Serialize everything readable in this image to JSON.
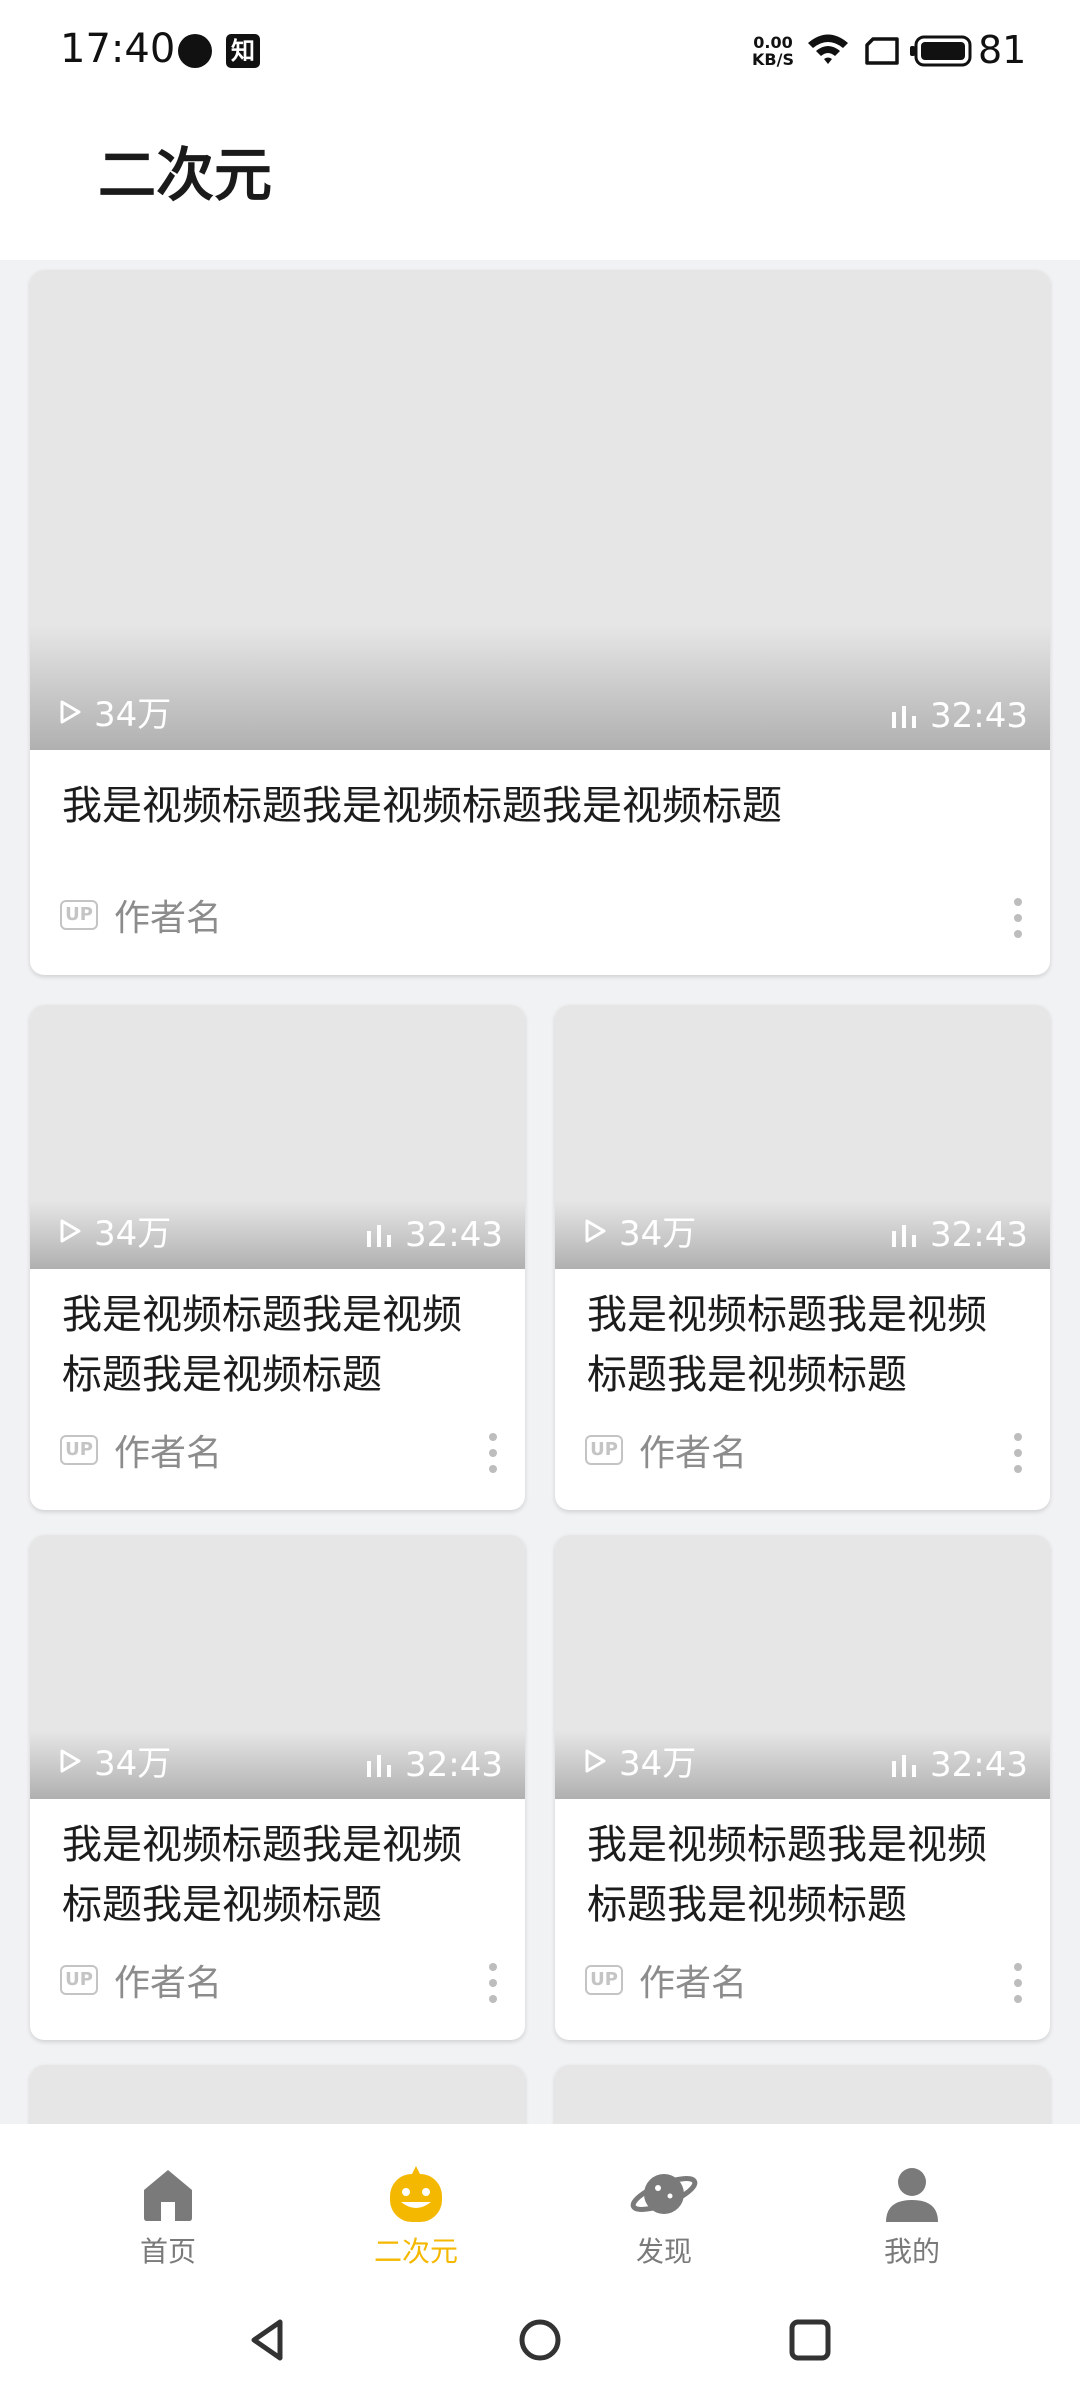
{
  "status_bar": {
    "time": "17:40",
    "app_badge": "知",
    "net_speed_value": "0.00",
    "net_speed_unit": "KB/S",
    "battery": "81"
  },
  "header": {
    "title": "二次元"
  },
  "colors": {
    "accent": "#f5b800",
    "inactive": "#7a7a7a",
    "background": "#f1f2f4"
  },
  "feed": {
    "featured": {
      "plays": "34万",
      "duration": "32:43",
      "title": "我是视频标题我是视频标题我是视频标题",
      "author": "作者名",
      "up_badge": "UP"
    },
    "grid": [
      {
        "plays": "34万",
        "duration": "32:43",
        "title": "我是视频标题我是视频标题我是视频标题",
        "author": "作者名",
        "up_badge": "UP"
      },
      {
        "plays": "34万",
        "duration": "32:43",
        "title": "我是视频标题我是视频标题我是视频标题",
        "author": "作者名",
        "up_badge": "UP"
      },
      {
        "plays": "34万",
        "duration": "32:43",
        "title": "我是视频标题我是视频标题我是视频标题",
        "author": "作者名",
        "up_badge": "UP"
      },
      {
        "plays": "34万",
        "duration": "32:43",
        "title": "我是视频标题我是视频标题我是视频标题",
        "author": "作者名",
        "up_badge": "UP"
      }
    ]
  },
  "bottom_nav": {
    "items": [
      {
        "label": "首页",
        "icon": "home-icon",
        "active": false
      },
      {
        "label": "二次元",
        "icon": "mascot-icon",
        "active": true
      },
      {
        "label": "发现",
        "icon": "planet-icon",
        "active": false
      },
      {
        "label": "我的",
        "icon": "person-icon",
        "active": false
      }
    ]
  },
  "system_nav": {
    "buttons": [
      "back-icon",
      "home-circle-icon",
      "recents-icon"
    ]
  }
}
